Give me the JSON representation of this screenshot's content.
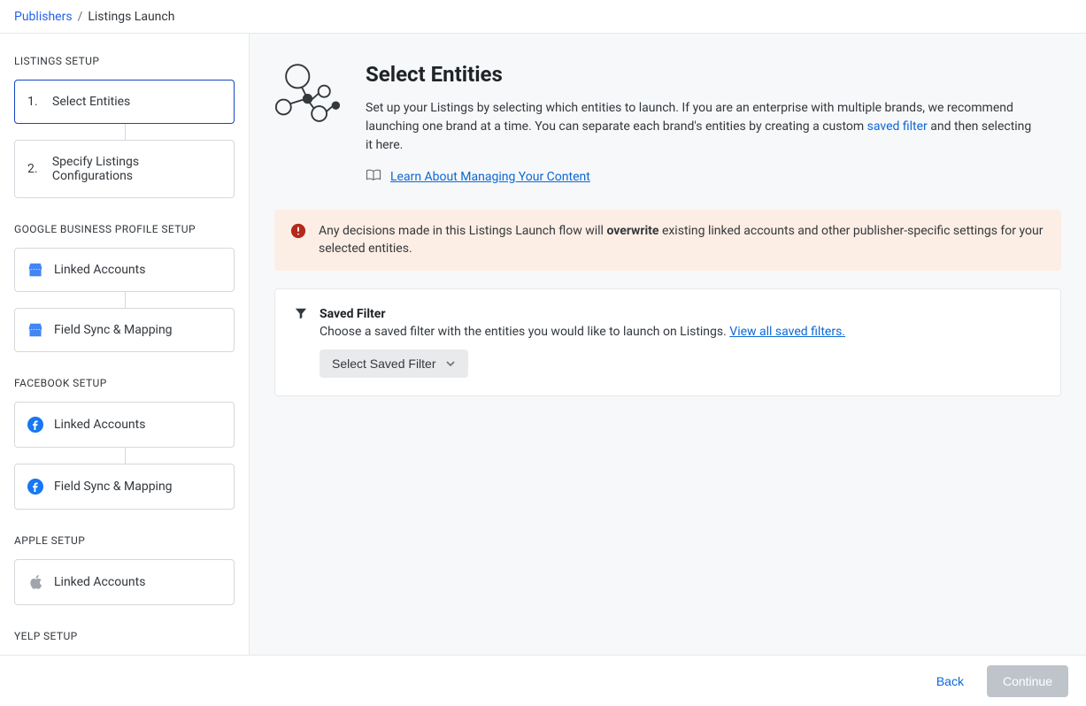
{
  "breadcrumb": {
    "root": "Publishers",
    "separator": "/",
    "current": "Listings Launch"
  },
  "sidebar": {
    "section_listings": "LISTINGS SETUP",
    "steps": [
      {
        "num": "1.",
        "label": "Select Entities"
      },
      {
        "num": "2.",
        "label": "Specify Listings Configurations"
      }
    ],
    "groups": [
      {
        "title": "GOOGLE BUSINESS PROFILE SETUP",
        "icon": "google",
        "items": [
          "Linked Accounts",
          "Field Sync & Mapping"
        ]
      },
      {
        "title": "FACEBOOK SETUP",
        "icon": "facebook",
        "items": [
          "Linked Accounts",
          "Field Sync & Mapping"
        ]
      },
      {
        "title": "APPLE SETUP",
        "icon": "apple",
        "items": [
          "Linked Accounts"
        ]
      },
      {
        "title": "YELP SETUP",
        "icon": "yelp",
        "items": []
      }
    ]
  },
  "hero": {
    "title": "Select Entities",
    "desc_before": "Set up your Listings by selecting which entities to launch. If you are an enterprise with multiple brands, we recommend launching one brand at a time. You can separate each brand's entities by creating a custom ",
    "desc_link": "saved filter",
    "desc_after": " and then selecting it here.",
    "learn_link": "Learn About Managing Your Content"
  },
  "alert": {
    "before": "Any decisions made in this Listings Launch flow will ",
    "bold": "overwrite",
    "after": " existing linked accounts and other publisher-specific settings for your selected entities."
  },
  "filter": {
    "title": "Saved Filter",
    "desc_before": "Choose a saved filter with the entities you would like to launch on Listings. ",
    "desc_link": "View all saved filters.",
    "dropdown": "Select Saved Filter"
  },
  "footer": {
    "back": "Back",
    "continue": "Continue"
  }
}
